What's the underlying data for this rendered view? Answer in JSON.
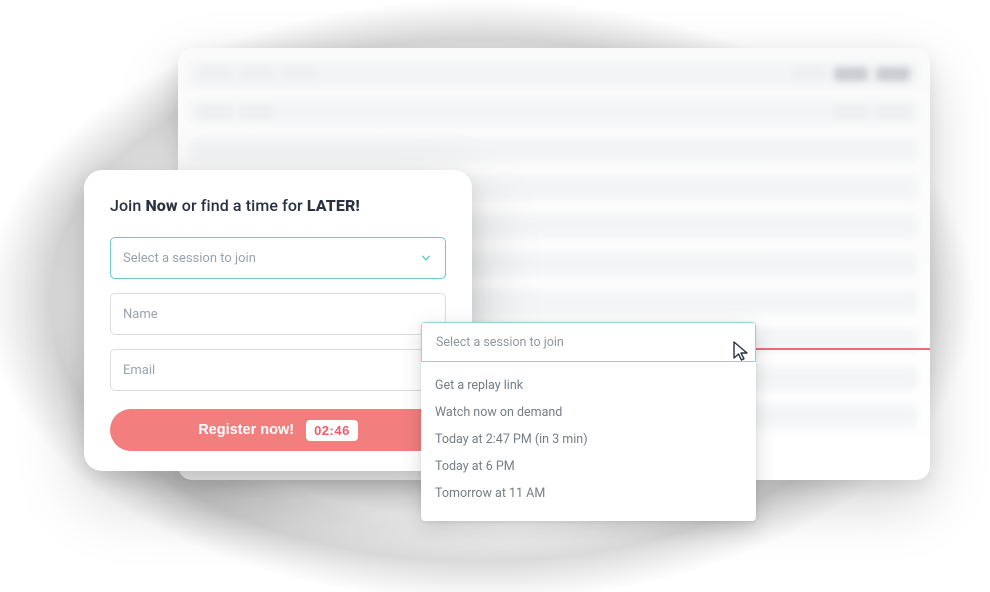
{
  "heading": {
    "prefix": "Join ",
    "bold1": "Now",
    "middle": " or find a time for ",
    "bold2": "LATER!"
  },
  "form": {
    "session_select_placeholder": "Select a session to join",
    "name_placeholder": "Name",
    "email_placeholder": "Email",
    "register_label": "Register now!",
    "timer": "02:46"
  },
  "dropdown": {
    "header": "Select a session to join",
    "options": [
      "Get a replay link",
      "Watch now on demand",
      "Today at 2:47 PM (in 3 min)",
      "Today at 6 PM",
      "Tomorrow at 11 AM"
    ]
  },
  "colors": {
    "accent_red": "#f06a77",
    "button_bg": "#f27e7e",
    "select_border": "#6fc7c9",
    "text_dark": "#2a3140"
  }
}
